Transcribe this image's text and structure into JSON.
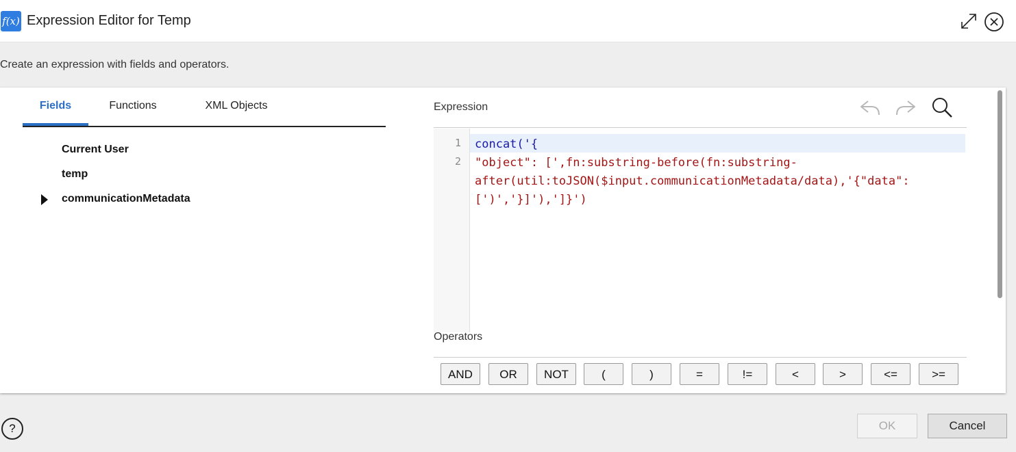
{
  "window": {
    "title": "Expression Editor for Temp",
    "icon_text": "f(x)",
    "subtitle": "Create an expression with fields and operators."
  },
  "tabs": [
    {
      "label": "Fields",
      "active": true
    },
    {
      "label": "Functions",
      "active": false
    },
    {
      "label": "XML Objects",
      "active": false
    }
  ],
  "fields": [
    {
      "label": "Current User"
    },
    {
      "label": "temp"
    },
    {
      "label": "communicationMetadata",
      "expandable": true
    }
  ],
  "expression": {
    "label": "Expression",
    "line_numbers": [
      "1",
      "2"
    ],
    "code_line1": "concat('{",
    "code_line2": "\"object\": [',fn:substring-before(fn:substring-after(util:toJSON($input.communicationMetadata/data),'{\"data\":[')','}]'),']}')"
  },
  "operators": {
    "label": "Operators",
    "buttons": [
      "AND",
      "OR",
      "NOT",
      "(",
      ")",
      "=",
      "!=",
      "<",
      ">",
      "<=",
      ">="
    ]
  },
  "footer": {
    "help_label": "?",
    "ok_label": "OK",
    "cancel_label": "Cancel"
  },
  "colors": {
    "accent": "#2a6fc4",
    "icon_bg": "#2f7de0",
    "code_function": "#1a1aa6",
    "code_string": "#a31515"
  },
  "icons": [
    "expand-icon",
    "close-icon",
    "undo-icon",
    "redo-icon",
    "search-icon",
    "help-icon",
    "caret-right-icon"
  ]
}
